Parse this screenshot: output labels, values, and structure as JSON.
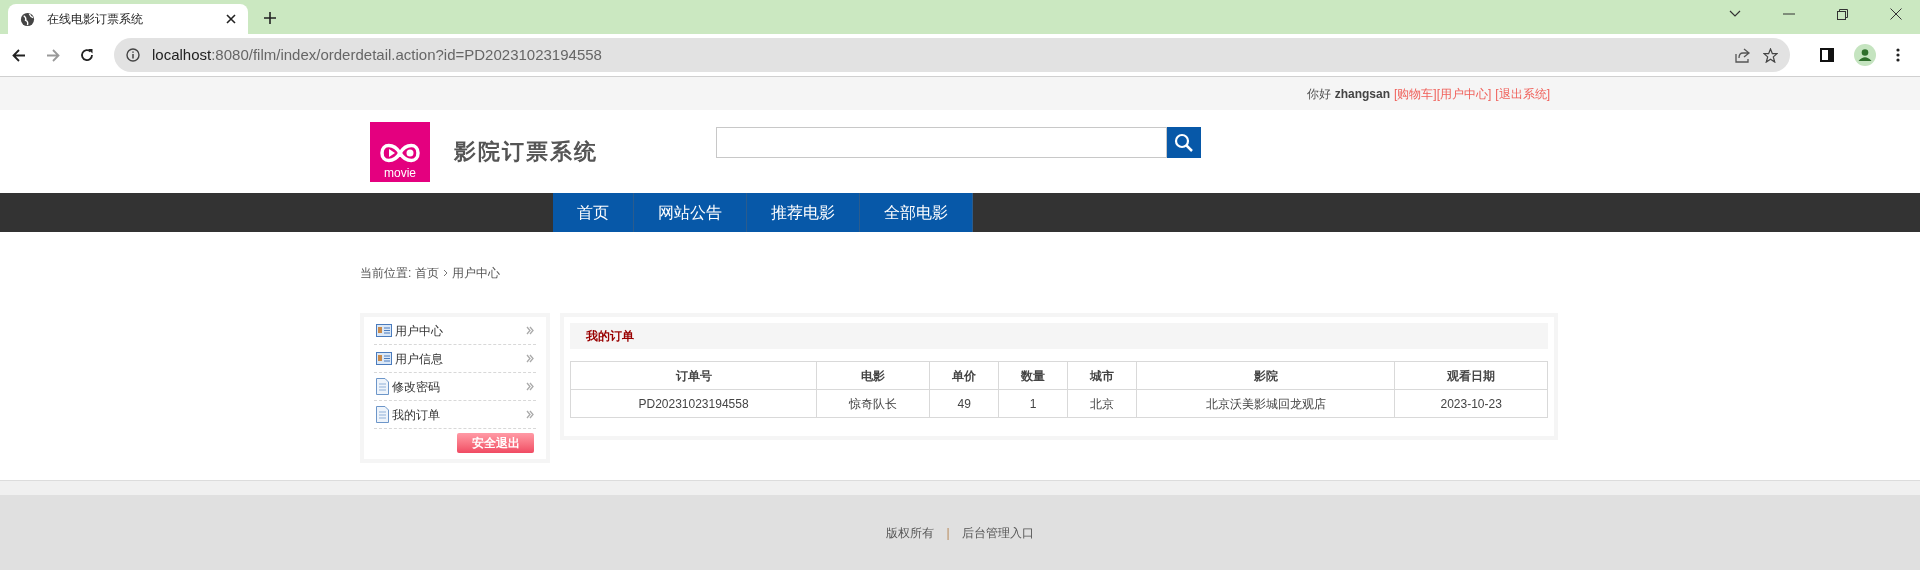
{
  "browser": {
    "tab_title": "在线电影订票系统",
    "url_host": "localhost",
    "url_rest": ":8080/film/index/orderdetail.action?id=PD20231023194558"
  },
  "top_bar": {
    "greeting": "你好",
    "username": "zhangsan",
    "links": [
      "[购物车]",
      "[用户中心]",
      "[退出系统]"
    ]
  },
  "header": {
    "logo_text": "movie",
    "site_title": "影院订票系统"
  },
  "nav": [
    "首页",
    "网站公告",
    "推荐电影",
    "全部电影"
  ],
  "breadcrumb": {
    "label": "当前位置:",
    "items": [
      "首页",
      "用户中心"
    ]
  },
  "sidebar": {
    "items": [
      {
        "label": "用户中心",
        "kind": "card"
      },
      {
        "label": "用户信息",
        "kind": "card"
      },
      {
        "label": "修改密码",
        "kind": "doc"
      },
      {
        "label": "我的订单",
        "kind": "doc"
      }
    ],
    "logout": "安全退出"
  },
  "orders": {
    "title": "我的订单",
    "columns": [
      "订单号",
      "电影",
      "单价",
      "数量",
      "城市",
      "影院",
      "观看日期"
    ],
    "rows": [
      [
        "PD20231023194558",
        "惊奇队长",
        "49",
        "1",
        "北京",
        "北京沃美影城回龙观店",
        "2023-10-23"
      ]
    ]
  },
  "footer": {
    "links": [
      "版权所有",
      "后台管理入口"
    ],
    "separator": "|"
  }
}
